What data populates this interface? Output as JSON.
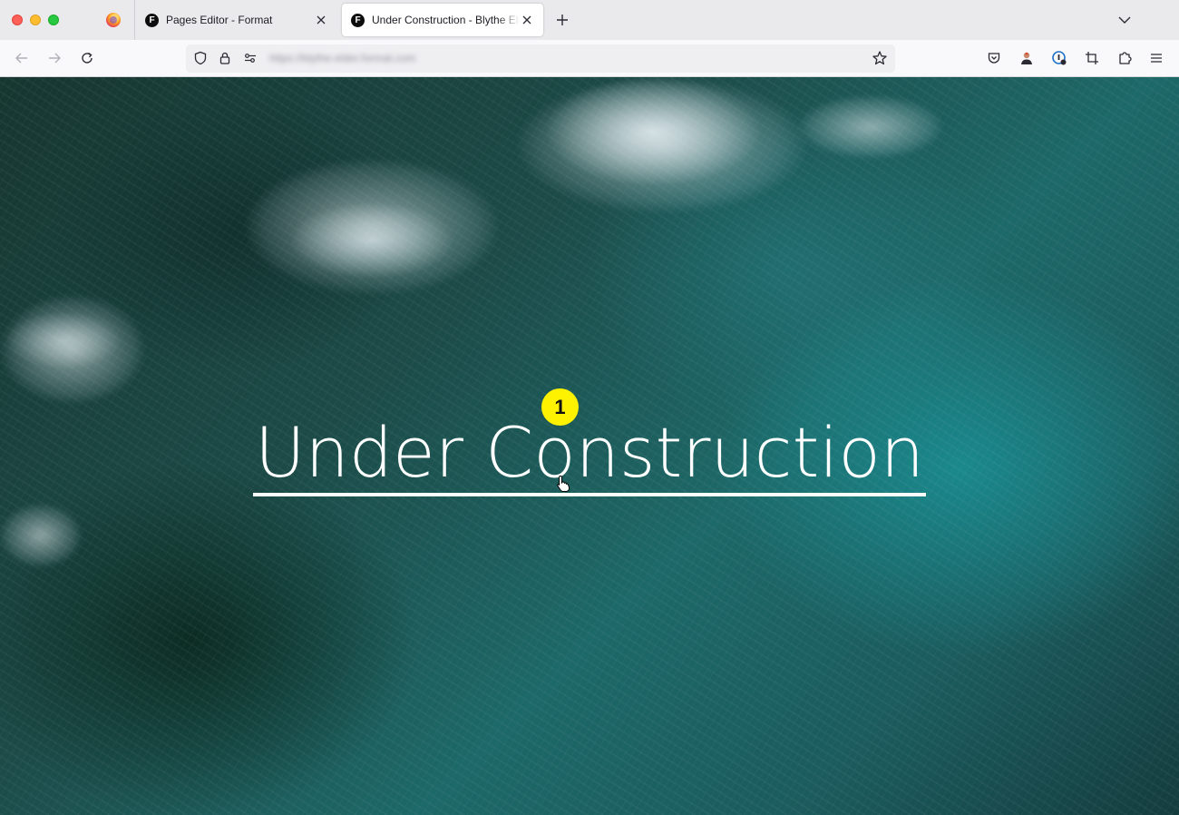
{
  "browser": {
    "tabs": [
      {
        "title": "Pages Editor - Format",
        "favicon_letter": "F",
        "active": false
      },
      {
        "title": "Under Construction - Blythe Elder",
        "favicon_letter": "F",
        "active": true
      }
    ],
    "url": "https://blythe-elder.format.com"
  },
  "page": {
    "headline": "Under Construction",
    "step_badge": "1"
  },
  "colors": {
    "accent_badge": "#fff200",
    "headline": "#ffffff"
  }
}
